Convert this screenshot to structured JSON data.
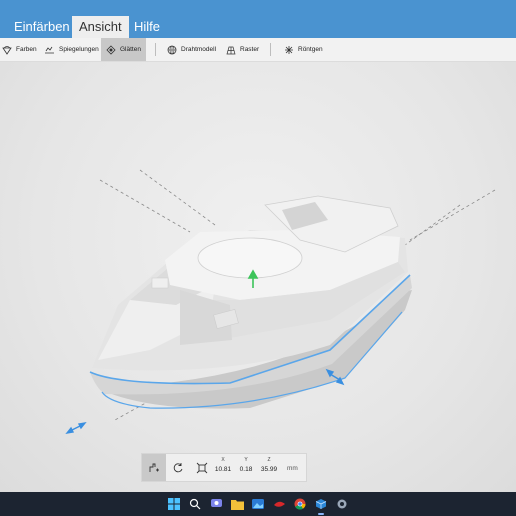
{
  "tabs": [
    {
      "label": "Einfärben",
      "active": false
    },
    {
      "label": "Ansicht",
      "active": true
    },
    {
      "label": "Hilfe",
      "active": false
    }
  ],
  "ribbon": {
    "items": [
      {
        "label": "Farben",
        "icon": "colors-icon",
        "active": false
      },
      {
        "label": "Spiegelungen",
        "icon": "reflections-icon",
        "active": false
      },
      {
        "label": "Glätten",
        "icon": "smooth-icon",
        "active": true
      },
      {
        "label": "Drahtmodell",
        "icon": "wireframe-icon",
        "active": false
      },
      {
        "label": "Raster",
        "icon": "grid-icon",
        "active": false
      },
      {
        "label": "Röntgen",
        "icon": "xray-icon",
        "active": false
      }
    ]
  },
  "bottom_toolbar": {
    "tools": [
      "move-tool-icon",
      "rotate-tool-icon",
      "scale-tool-icon"
    ],
    "coords": [
      {
        "axis": "X",
        "value": "10.81"
      },
      {
        "axis": "Y",
        "value": "0.18"
      },
      {
        "axis": "Z",
        "value": "35.99"
      }
    ],
    "unit": "mm"
  },
  "taskbar": {
    "icons": [
      "windows-start-icon",
      "search-icon",
      "chat-icon",
      "file-explorer-icon",
      "photos-icon",
      "app-red-icon",
      "chrome-icon",
      "3d-viewer-icon",
      "settings-icon"
    ]
  },
  "colors": {
    "accent": "#4a93d0",
    "selection_outline": "#5aa6ea",
    "gizmo_green": "#3cc45a",
    "taskbar": "#1c2431"
  }
}
